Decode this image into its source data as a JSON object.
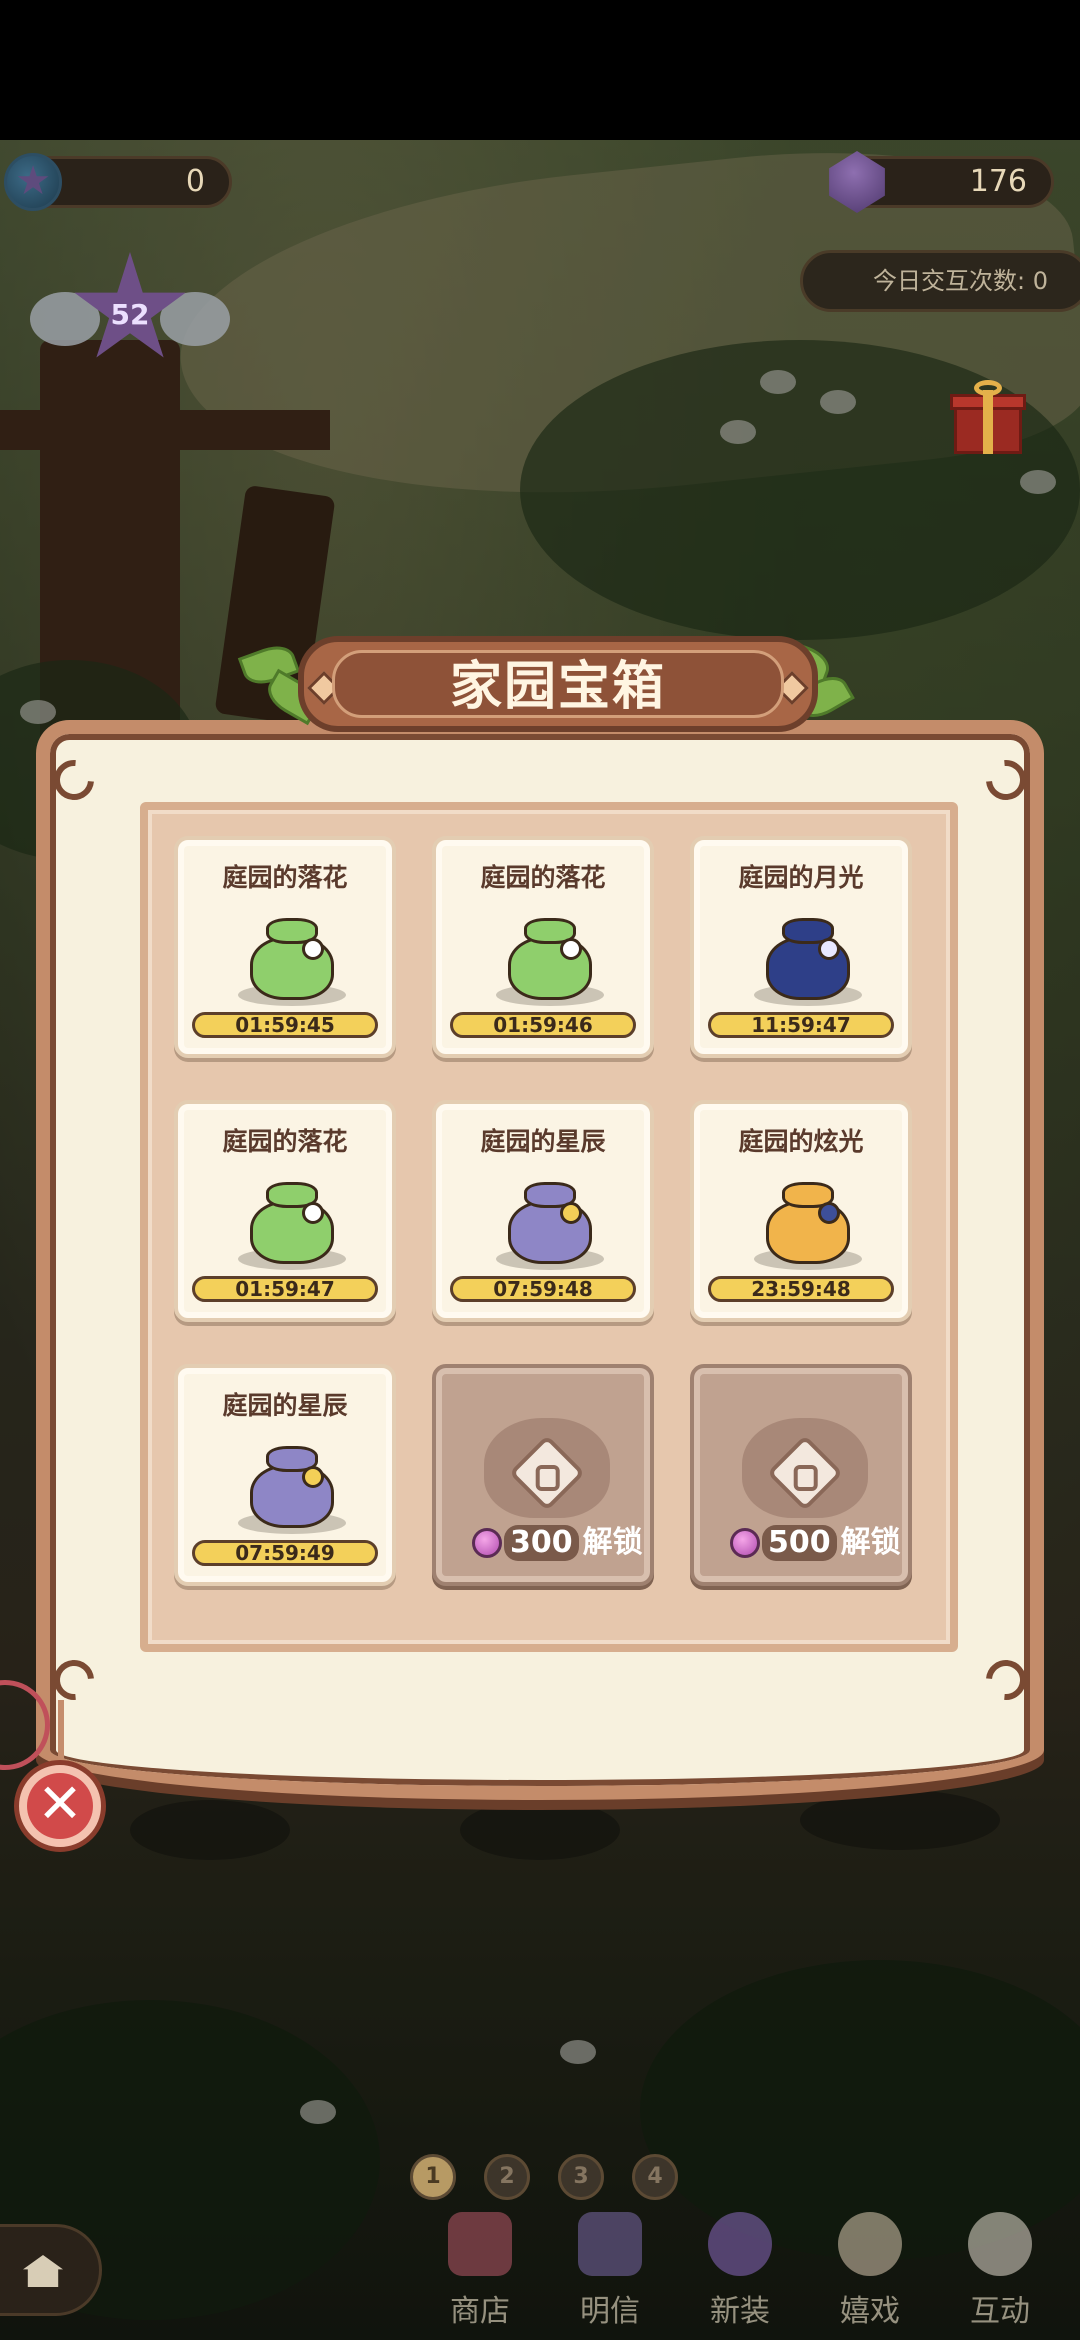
{
  "hud": {
    "star_count": "0",
    "gem_count": "176",
    "interaction_label": "今日交互次数: 0",
    "level": "52"
  },
  "dialog": {
    "title": "家园宝箱",
    "chests": [
      {
        "name": "庭园的落花",
        "timer": "01:59:45",
        "bag": "green-bag-icon"
      },
      {
        "name": "庭园的落花",
        "timer": "01:59:46",
        "bag": "green-bag-icon"
      },
      {
        "name": "庭园的月光",
        "timer": "11:59:47",
        "bag": "moonlight-bag-icon"
      },
      {
        "name": "庭园的落花",
        "timer": "01:59:47",
        "bag": "green-bag-icon"
      },
      {
        "name": "庭园的星辰",
        "timer": "07:59:48",
        "bag": "star-bag-icon"
      },
      {
        "name": "庭园的炫光",
        "timer": "23:59:48",
        "bag": "gold-bag-icon"
      },
      {
        "name": "庭园的星辰",
        "timer": "07:59:49",
        "bag": "star-bag-icon"
      }
    ],
    "locked_slots": [
      {
        "cost": "300",
        "label": "解锁"
      },
      {
        "cost": "500",
        "label": "解锁"
      }
    ],
    "close_symbol": "✕"
  },
  "pager": [
    "1",
    "2",
    "3",
    "4"
  ],
  "bottom_nav": [
    {
      "label": "商店",
      "icon": "shop-icon"
    },
    {
      "label": "明信",
      "icon": "postcard-icon"
    },
    {
      "label": "新装",
      "icon": "outfit-icon"
    },
    {
      "label": "嬉戏",
      "icon": "play-icon"
    },
    {
      "label": "互动",
      "icon": "interact-icon"
    }
  ],
  "colors": {
    "dialog_bg": "#f7f1de",
    "frame": "#c48c6a",
    "timer_bar": "#f3d05a",
    "close_red": "#d14a4a"
  }
}
